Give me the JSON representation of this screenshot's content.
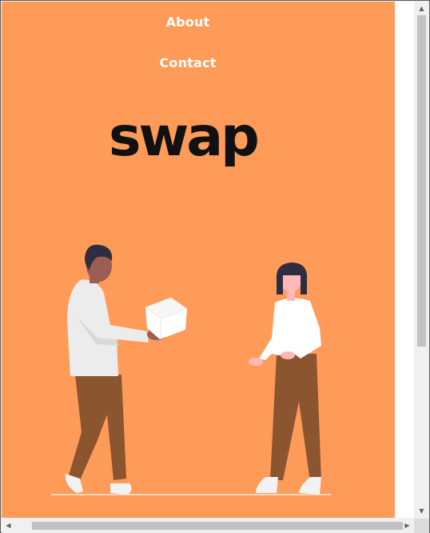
{
  "nav": {
    "about": "About",
    "contact": "Contact"
  },
  "brand": {
    "logo_text": "swap"
  },
  "illustration": {
    "description_icon": "people-exchanging-box-illustration"
  },
  "colors": {
    "background": "#ff9b59",
    "text": "#ffffff",
    "logo": "#111111",
    "trousers": "#8b5530",
    "shirt": "#f2f2f2",
    "skin_dark": "#9c5d52",
    "skin_light": "#ffb8b8",
    "hair": "#2f2e41"
  },
  "scrollbars": {
    "up_arrow": "▲",
    "down_arrow": "▼",
    "left_arrow": "◀",
    "right_arrow": "▶"
  }
}
